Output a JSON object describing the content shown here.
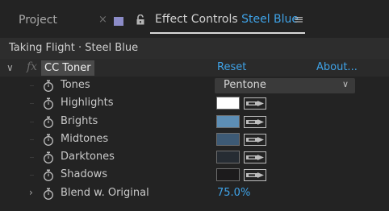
{
  "tabs": {
    "project_label": "Project",
    "close_glyph": "×",
    "menu_glyph": "≡",
    "effect_controls_label": "Effect Controls",
    "layer_name": "Steel Blue"
  },
  "breadcrumb": "Taking Flight · Steel Blue",
  "effect": {
    "fx_badge": "fx",
    "name": "CC Toner",
    "reset_label": "Reset",
    "about_label": "About...",
    "properties": [
      {
        "label": "Tones",
        "type": "dropdown",
        "value": "Pentone"
      },
      {
        "label": "Highlights",
        "type": "color",
        "color": "#ffffff"
      },
      {
        "label": "Brights",
        "type": "color",
        "color": "#5d8eb5"
      },
      {
        "label": "Midtones",
        "type": "color",
        "color": "#3d5a75"
      },
      {
        "label": "Darktones",
        "type": "color",
        "color": "#262c33"
      },
      {
        "label": "Shadows",
        "type": "color",
        "color": "#1c1b1c"
      },
      {
        "label": "Blend w. Original",
        "type": "percent",
        "value": "75.0",
        "unit": "%"
      }
    ]
  },
  "colors": {
    "accent": "#3fa3e8",
    "panel_bg": "#232323"
  },
  "icons": {
    "stopwatch": "stopwatch-icon",
    "eyedropper": "eyedropper-icon",
    "lock": "lock-icon",
    "expand": "chevron-right-icon",
    "collapse": "chevron-down-icon"
  }
}
